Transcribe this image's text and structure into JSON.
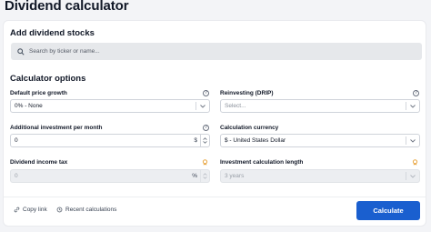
{
  "page": {
    "title": "Dividend calculator"
  },
  "add_section": {
    "heading": "Add dividend stocks",
    "search_placeholder": "Search by ticker or name..."
  },
  "options_section": {
    "heading": "Calculator options",
    "price_growth": {
      "label": "Default price growth",
      "value": "0% - None"
    },
    "drip": {
      "label": "Reinvesting (DRIP)",
      "placeholder": "Select..."
    },
    "additional_investment": {
      "label": "Additional investment per month",
      "value": "0",
      "unit": "$"
    },
    "currency": {
      "label": "Calculation currency",
      "value": "$ - United States Dollar"
    },
    "income_tax": {
      "label": "Dividend income tax",
      "value": "0",
      "unit": "%"
    },
    "length": {
      "label": "Investment calculation length",
      "value": "3 years"
    }
  },
  "footer": {
    "copy_link": "Copy link",
    "recent": "Recent calculations",
    "calculate": "Calculate"
  },
  "colors": {
    "accent": "#1a5fcf",
    "pro_badge": "#e8a33c"
  }
}
